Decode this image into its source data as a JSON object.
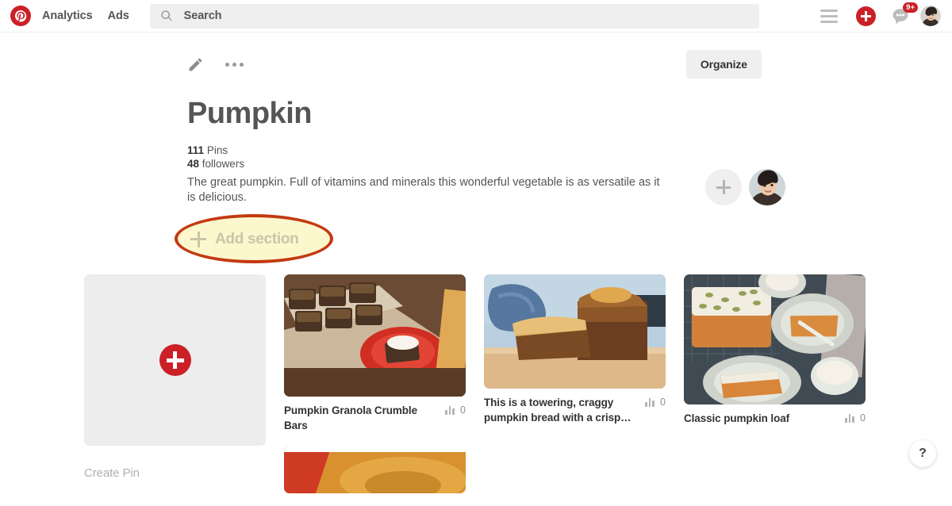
{
  "header": {
    "logo_icon": "pinterest-logo-icon",
    "nav": [
      {
        "label": "Analytics"
      },
      {
        "label": "Ads"
      }
    ],
    "search": {
      "icon": "search-icon",
      "placeholder": "Search",
      "value": ""
    },
    "actions": {
      "menu_icon": "hamburger-menu-icon",
      "create_icon": "plus-circle-icon",
      "messages_icon": "chat-bubble-icon",
      "messages_badge": "9+",
      "avatar_icon": "user-avatar"
    }
  },
  "board": {
    "edit_icon": "pencil-icon",
    "more_icon": "more-options-icon",
    "organize_label": "Organize",
    "title": "Pumpkin",
    "pins_count": "111",
    "pins_label": "Pins",
    "followers_count": "48",
    "followers_label": "followers",
    "description": "The great pumpkin. Full of vitamins and minerals this wonderful vegetable is as versatile as it is delicious.",
    "collaborator_add_icon": "add-collaborator-icon",
    "owner_avatar_icon": "board-owner-avatar",
    "add_section_label": "Add section",
    "add_section_icon": "plus-icon"
  },
  "highlight": {
    "target": "add-section-button",
    "border_color": "#c33a12",
    "fill_color": "#fcf7cd"
  },
  "create_pin": {
    "label": "Create Pin",
    "icon": "plus-circle-icon"
  },
  "pins": [
    {
      "title": "Pumpkin Granola Crumble Bars",
      "stats_icon": "bar-chart-icon",
      "stats_count": "0",
      "image_alt": "pumpkin granola crumble bars on wooden board with red plate"
    },
    {
      "title": "This is a towering, craggy pumpkin bread with a crisp…",
      "stats_icon": "bar-chart-icon",
      "stats_count": "0",
      "image_alt": "sliced pumpkin bread loaf on cutting board with blue cloth"
    },
    {
      "title": "Classic pumpkin loaf",
      "stats_icon": "bar-chart-icon",
      "stats_count": "0",
      "image_alt": "frosted pumpkin loaf with seeds and plated slices"
    }
  ],
  "help": {
    "label": "?"
  },
  "colors": {
    "brand_red": "#cb2027",
    "text_dark": "#333333",
    "text_gray": "#555555",
    "surface_gray": "#efefef"
  }
}
